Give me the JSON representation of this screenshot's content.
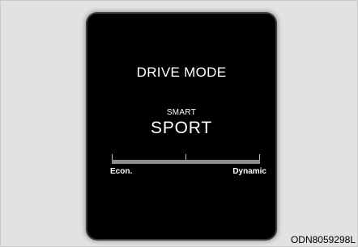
{
  "display": {
    "title": "DRIVE MODE",
    "submode": "SMART",
    "mode": "SPORT",
    "scale": {
      "left_label": "Econ.",
      "right_label": "Dynamic"
    }
  },
  "figure_code": "ODN8059298L"
}
